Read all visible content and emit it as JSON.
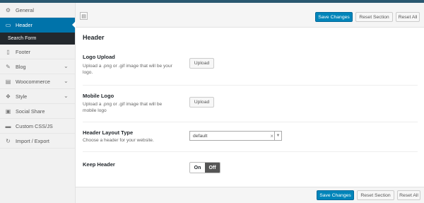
{
  "sidebar": {
    "items": [
      {
        "label": "General",
        "icon": "gears-icon",
        "glyph": "⚙"
      },
      {
        "label": "Header",
        "icon": "header-icon",
        "glyph": "▭"
      },
      {
        "label": "Footer",
        "icon": "footer-icon",
        "glyph": "▯"
      },
      {
        "label": "Blog",
        "icon": "pencil-icon",
        "glyph": "✎"
      },
      {
        "label": "Woocommerce",
        "icon": "bag-icon",
        "glyph": "▤"
      },
      {
        "label": "Style",
        "icon": "palette-icon",
        "glyph": "❖"
      },
      {
        "label": "Social Share",
        "icon": "share-icon",
        "glyph": "▣"
      },
      {
        "label": "Custom CSS/JS",
        "icon": "code-icon",
        "glyph": "▬"
      },
      {
        "label": "Import / Export",
        "icon": "refresh-icon",
        "glyph": "↻"
      }
    ],
    "subitem": "Search Form"
  },
  "toolbar": {
    "save": "Save Changes",
    "reset_section": "Reset Section",
    "reset_all": "Reset All"
  },
  "section": {
    "title": "Header"
  },
  "fields": {
    "logo_upload": {
      "label": "Logo Upload",
      "desc": "Upload a .png or .gif image that will be your logo.",
      "button": "Upload"
    },
    "mobile_logo": {
      "label": "Mobile Logo",
      "desc": "Upload a .png or .gif image that will be mobile logo",
      "button": "Upload"
    },
    "header_layout": {
      "label": "Header Layout Type",
      "desc": "Choose a header for your website.",
      "selected": "default"
    },
    "keep_header": {
      "label": "Keep Header",
      "on": "On",
      "off": "Off"
    }
  },
  "colors": {
    "accent": "#0073aa",
    "primary_button": "#0085ba",
    "submenu_bg": "#23282d"
  }
}
